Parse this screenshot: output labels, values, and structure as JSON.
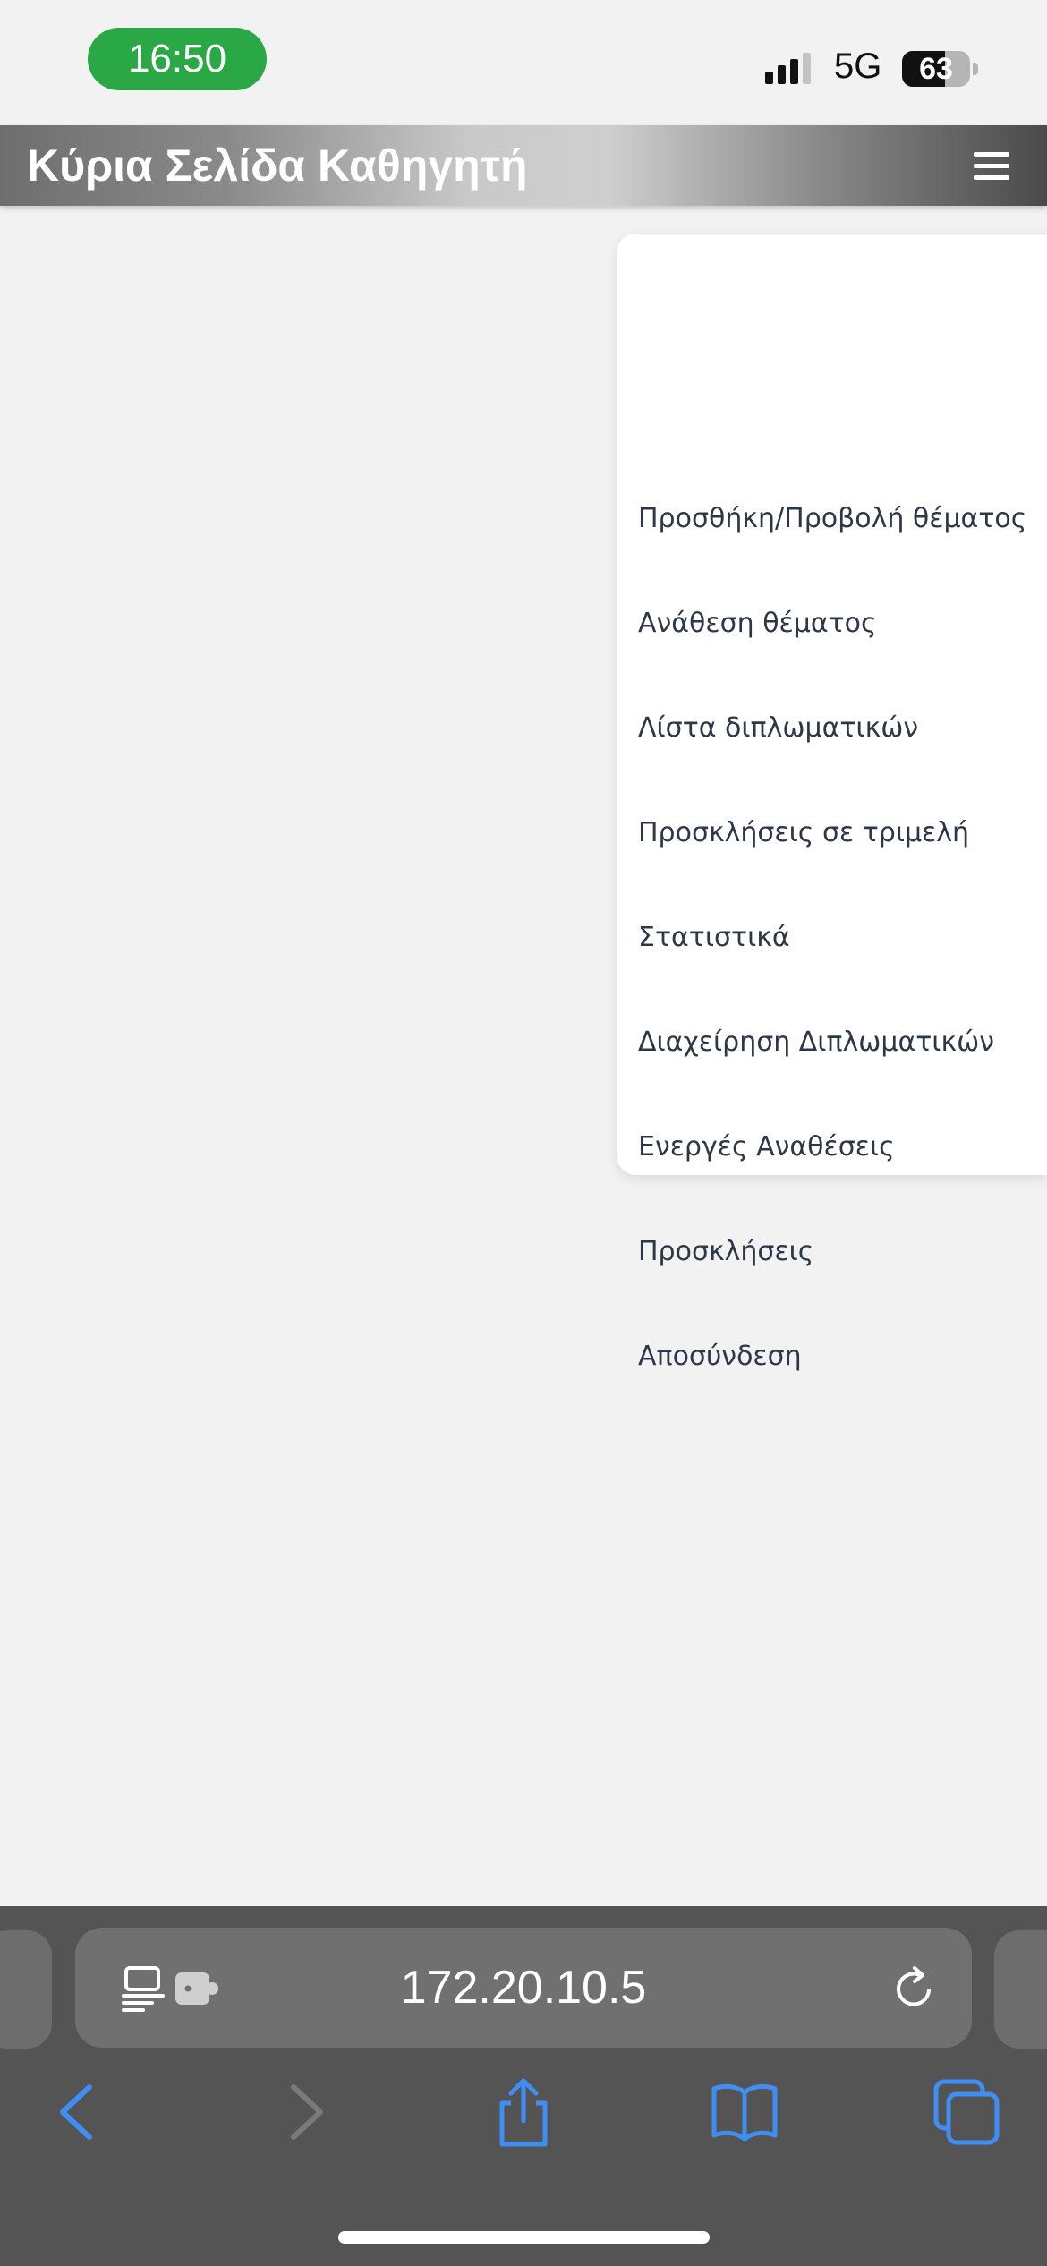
{
  "status_bar": {
    "time": "16:50",
    "network": "5G",
    "battery_level": "63",
    "battery_fraction": 0.63
  },
  "header": {
    "title": "Κύρια Σελίδα Καθηγητή",
    "menu_icon": "hamburger-menu-icon"
  },
  "menu": {
    "items": [
      "Προσθήκη/Προβολή θέματος",
      "Ανάθεση θέματος",
      "Λίστα διπλωματικών",
      "Προσκλήσεις σε τριμελή",
      "Στατιστικά",
      "Διαχείρηση Διπλωματικών",
      "Ενεργές Αναθέσεις",
      "Προσκλήσεις",
      "Αποσύνδεση"
    ]
  },
  "browser": {
    "url": "172.20.10.5",
    "icons": {
      "reader": "page-menu-icon",
      "extension": "extension-icon",
      "reload": "reload-icon",
      "back": "back-chevron-icon",
      "forward": "forward-chevron-icon",
      "share": "share-icon",
      "bookmarks": "bookmarks-book-icon",
      "tabs": "tabs-icon"
    },
    "colors": {
      "toolbar_active": "#3f8ef5",
      "toolbar_disabled": "#7a7a7a"
    }
  },
  "colors": {
    "time_pill": "#2aa845",
    "page_background": "#f2f2f2",
    "menu_text": "#2d3748",
    "chrome_background": "#545454"
  }
}
